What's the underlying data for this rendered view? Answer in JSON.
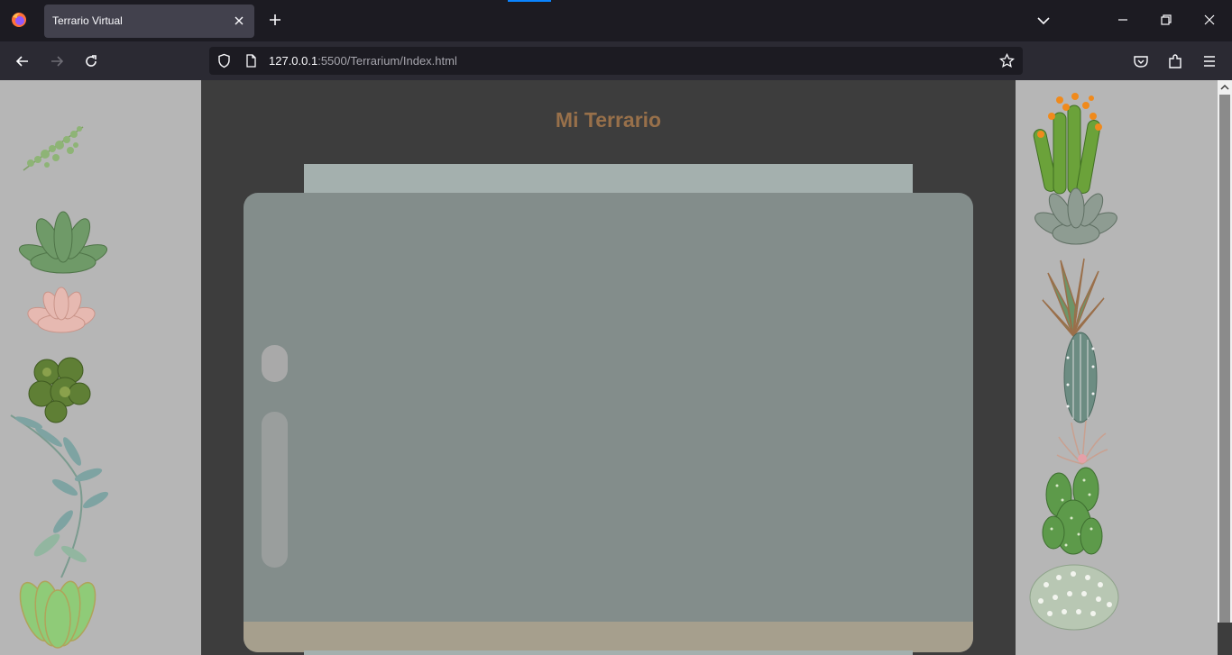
{
  "browser": {
    "tab_title": "Terrario Virtual",
    "url_host": "127.0.0.1",
    "url_rest": ":5500/Terrarium/Index.html"
  },
  "icons": {
    "browser_logo": "firefox-icon",
    "tab_close": "close-icon",
    "new_tab": "plus-icon",
    "tab_list": "chevron-down-icon",
    "minimize": "minimize-icon",
    "maximize": "restore-icon",
    "close_window": "close-icon",
    "back": "arrow-left-icon",
    "forward": "arrow-right-icon",
    "reload": "reload-icon",
    "tracking_protection": "shield-icon",
    "page_info": "page-icon",
    "bookmark": "star-icon",
    "pocket": "pocket-icon",
    "extensions": "puzzle-icon",
    "menu": "hamburger-icon"
  },
  "page": {
    "title": "Mi Terrario",
    "colors": {
      "title": "#98704a",
      "jar_glass": "#838d8b",
      "jar_top": "#a4b0ae",
      "dirt": "#a69f8d",
      "side_panel": "#b6b6b6",
      "center_bg": "#3d3d3d"
    },
    "left_plants": [
      "plant1",
      "plant2",
      "plant3",
      "plant4",
      "plant5",
      "plant6",
      "plant7"
    ],
    "right_plants": [
      "plant8",
      "plant9",
      "plant10",
      "plant11",
      "plant12",
      "plant13",
      "plant14"
    ]
  }
}
